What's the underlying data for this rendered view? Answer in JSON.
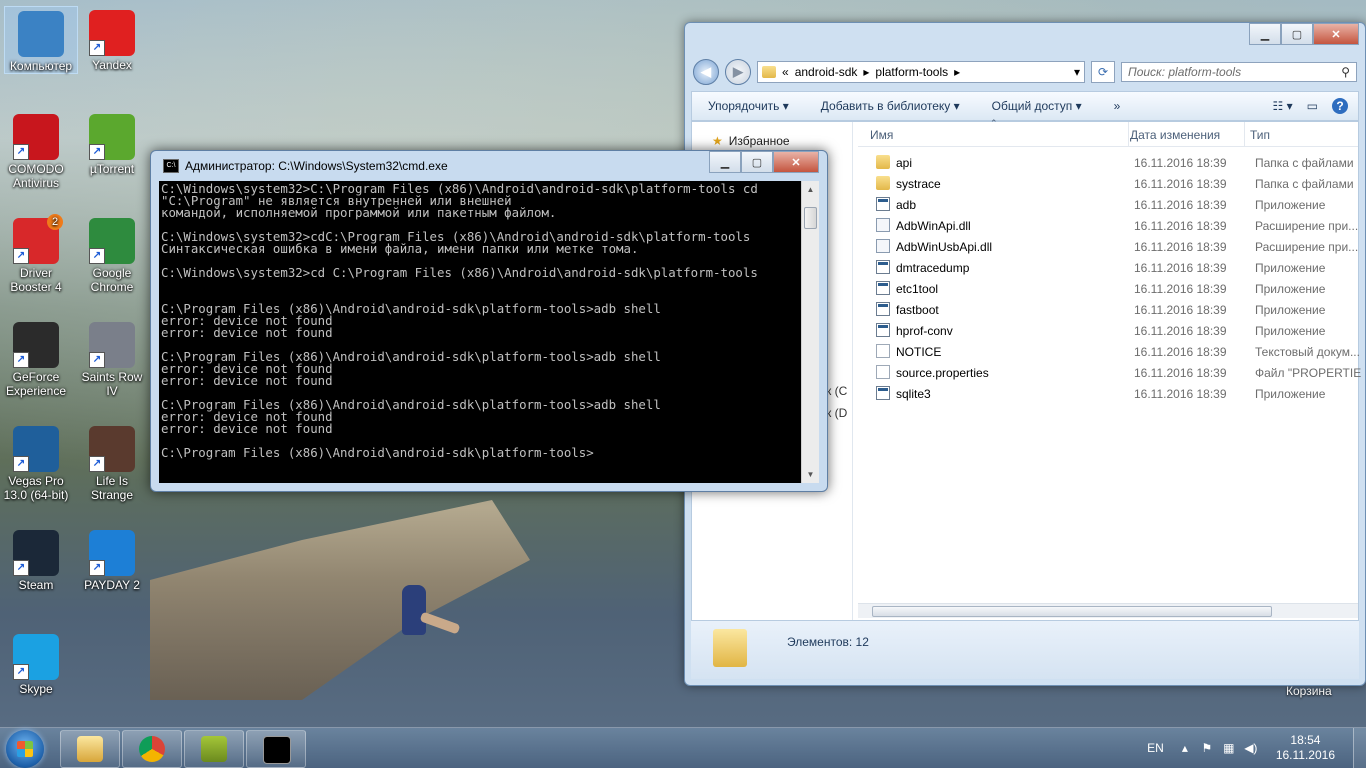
{
  "desktop": {
    "icons": [
      {
        "label": "Компьютер",
        "icon": "computer-icon",
        "color": "#3b82c4"
      },
      {
        "label": "Yandex",
        "icon": "yandex-icon",
        "color": "#e02020"
      },
      {
        "label": "COMODO Antivirus",
        "icon": "comodo-icon",
        "color": "#c8161d"
      },
      {
        "label": "µTorrent",
        "icon": "utorrent-icon",
        "color": "#5ba82e"
      },
      {
        "label": "Driver Booster 4",
        "icon": "driver-booster-icon",
        "color": "#d8282a",
        "badge": "2"
      },
      {
        "label": "Google Chrome",
        "icon": "chrome-icon",
        "color": "#2e8b3e"
      },
      {
        "label": "GeForce Experience",
        "icon": "geforce-icon",
        "color": "#2b2b2b"
      },
      {
        "label": "Saints Row IV",
        "icon": "saints-row-icon",
        "color": "#7a7f8a"
      },
      {
        "label": "Vegas Pro 13.0 (64-bit)",
        "icon": "vegas-pro-icon",
        "color": "#1f5f9b"
      },
      {
        "label": "Life Is Strange",
        "icon": "life-is-strange-icon",
        "color": "#5a3a2e"
      },
      {
        "label": "Steam",
        "icon": "steam-icon",
        "color": "#1b2838"
      },
      {
        "label": "PAYDAY 2",
        "icon": "payday2-icon",
        "color": "#1d7fd6"
      },
      {
        "label": "Skype",
        "icon": "skype-icon",
        "color": "#1ba1e2"
      }
    ],
    "recycle_bin_label": "Корзина"
  },
  "cmd": {
    "title": "Администратор: C:\\Windows\\System32\\cmd.exe",
    "lines": [
      "C:\\Windows\\system32>C:\\Program Files (x86)\\Android\\android-sdk\\platform-tools cd",
      "\"C:\\Program\" не является внутренней или внешней",
      "командой, исполняемой программой или пакетным файлом.",
      "",
      "C:\\Windows\\system32>cdC:\\Program Files (x86)\\Android\\android-sdk\\platform-tools",
      "Синтаксическая ошибка в имени файла, имени папки или метке тома.",
      "",
      "C:\\Windows\\system32>cd C:\\Program Files (x86)\\Android\\android-sdk\\platform-tools",
      "",
      "",
      "C:\\Program Files (x86)\\Android\\android-sdk\\platform-tools>adb shell",
      "error: device not found",
      "error: device not found",
      "",
      "C:\\Program Files (x86)\\Android\\android-sdk\\platform-tools>adb shell",
      "error: device not found",
      "error: device not found",
      "",
      "C:\\Program Files (x86)\\Android\\android-sdk\\platform-tools>adb shell",
      "error: device not found",
      "error: device not found",
      "",
      "C:\\Program Files (x86)\\Android\\android-sdk\\platform-tools>"
    ]
  },
  "explorer": {
    "breadcrumb_prefix": "«",
    "breadcrumb": [
      "android-sdk",
      "platform-tools"
    ],
    "search_placeholder": "Поиск: platform-tools",
    "toolbar": {
      "organize": "Упорядочить",
      "add_to_library": "Добавить в библиотеку",
      "share": "Общий доступ",
      "more": "»"
    },
    "nav": {
      "favorites": "Избранное",
      "clip1": "к (C",
      "clip2": "к (D"
    },
    "columns": {
      "name": "Имя",
      "date": "Дата изменения",
      "type": "Тип"
    },
    "files": [
      {
        "name": "api",
        "date": "16.11.2016 18:39",
        "type": "Папка с файлами",
        "kind": "folder"
      },
      {
        "name": "systrace",
        "date": "16.11.2016 18:39",
        "type": "Папка с файлами",
        "kind": "folder"
      },
      {
        "name": "adb",
        "date": "16.11.2016 18:39",
        "type": "Приложение",
        "kind": "exe"
      },
      {
        "name": "AdbWinApi.dll",
        "date": "16.11.2016 18:39",
        "type": "Расширение при...",
        "kind": "dll"
      },
      {
        "name": "AdbWinUsbApi.dll",
        "date": "16.11.2016 18:39",
        "type": "Расширение при...",
        "kind": "dll"
      },
      {
        "name": "dmtracedump",
        "date": "16.11.2016 18:39",
        "type": "Приложение",
        "kind": "exe"
      },
      {
        "name": "etc1tool",
        "date": "16.11.2016 18:39",
        "type": "Приложение",
        "kind": "exe"
      },
      {
        "name": "fastboot",
        "date": "16.11.2016 18:39",
        "type": "Приложение",
        "kind": "exe"
      },
      {
        "name": "hprof-conv",
        "date": "16.11.2016 18:39",
        "type": "Приложение",
        "kind": "exe"
      },
      {
        "name": "NOTICE",
        "date": "16.11.2016 18:39",
        "type": "Текстовый докум...",
        "kind": "txt"
      },
      {
        "name": "source.properties",
        "date": "16.11.2016 18:39",
        "type": "Файл \"PROPERTIE...",
        "kind": "txt"
      },
      {
        "name": "sqlite3",
        "date": "16.11.2016 18:39",
        "type": "Приложение",
        "kind": "exe"
      }
    ],
    "status_count": "Элементов: 12"
  },
  "taskbar": {
    "items": [
      "explorer",
      "chrome",
      "android-sdk-manager",
      "cmd"
    ],
    "language": "EN",
    "time": "18:54",
    "date": "16.11.2016"
  }
}
